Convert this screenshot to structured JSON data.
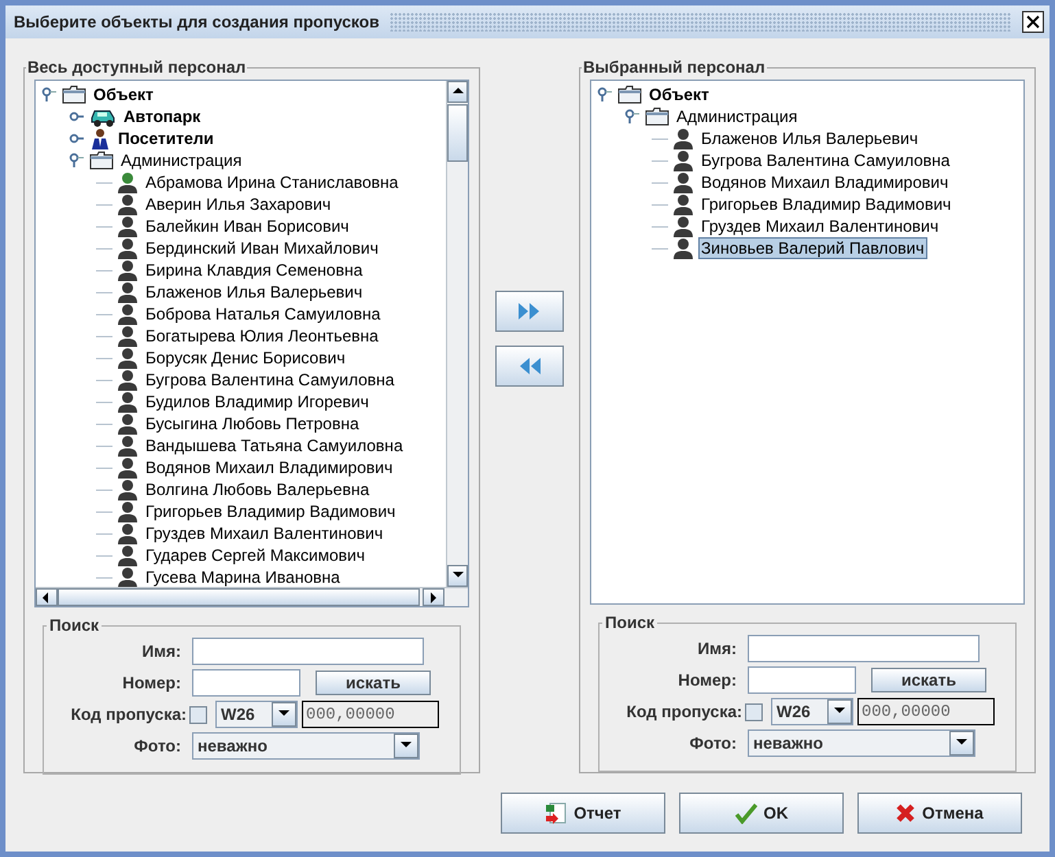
{
  "window": {
    "title": "Выберите объекты для создания пропусков"
  },
  "left_panel": {
    "title": "Весь доступный персонал",
    "tree": [
      {
        "label": "Объект",
        "kind": "folder",
        "bold": true,
        "expanded": true,
        "children": [
          {
            "label": "Автопарк",
            "kind": "car",
            "bold": true,
            "expanded": false
          },
          {
            "label": "Посетители",
            "kind": "visitor",
            "bold": true,
            "expanded": false
          },
          {
            "label": "Администрация",
            "kind": "folder",
            "bold": false,
            "expanded": true,
            "children": [
              {
                "label": "Абрамова Ирина Станиславовна",
                "kind": "green_person",
                "selected": false
              },
              {
                "label": "Аверин Илья Захарович",
                "kind": "person",
                "selected": false
              },
              {
                "label": "Балейкин Иван Борисович",
                "kind": "person",
                "selected": false
              },
              {
                "label": "Бердинский Иван Михайлович",
                "kind": "person",
                "selected": false
              },
              {
                "label": "Бирина Клавдия Семеновна",
                "kind": "person",
                "selected": false
              },
              {
                "label": "Блаженов Илья Валерьевич",
                "kind": "person",
                "selected": false
              },
              {
                "label": "Боброва Наталья Самуиловна",
                "kind": "person",
                "selected": false
              },
              {
                "label": "Богатырева Юлия Леонтьевна",
                "kind": "person",
                "selected": false
              },
              {
                "label": "Борусяк Денис Борисович",
                "kind": "person",
                "selected": false
              },
              {
                "label": "Бугрова Валентина Самуиловна",
                "kind": "person",
                "selected": false
              },
              {
                "label": "Будилов Владимир Игоревич",
                "kind": "person",
                "selected": false
              },
              {
                "label": "Бусыгина Любовь Петровна",
                "kind": "person",
                "selected": false
              },
              {
                "label": "Вандышева Татьяна Самуиловна",
                "kind": "person",
                "selected": false
              },
              {
                "label": "Водянов Михаил Владимирович",
                "kind": "person",
                "selected": false
              },
              {
                "label": "Волгина Любовь Валерьевна",
                "kind": "person",
                "selected": false
              },
              {
                "label": "Григорьев Владимир Вадимович",
                "kind": "person",
                "selected": false
              },
              {
                "label": "Груздев Михаил Валентинович",
                "kind": "person",
                "selected": false
              },
              {
                "label": "Гударев Сергей Максимович",
                "kind": "person",
                "selected": false
              },
              {
                "label": "Гусева Марина Ивановна",
                "kind": "person",
                "selected": false
              }
            ]
          }
        ]
      }
    ],
    "search": {
      "title": "Поиск",
      "name_label": "Имя:",
      "number_label": "Номер:",
      "search_button": "искать",
      "code_label": "Код пропуска:",
      "code_checked": false,
      "code_type": "W26",
      "code_value": "000,00000",
      "photo_label": "Фото:",
      "photo_value": "неважно"
    }
  },
  "move_buttons": [
    {
      "kind": "add"
    },
    {
      "kind": "remove"
    }
  ],
  "right_panel": {
    "title": "Выбранный персонал",
    "tree": [
      {
        "label": "Объект",
        "kind": "folder",
        "bold": true,
        "expanded": true,
        "children": [
          {
            "label": "Администрация",
            "kind": "folder",
            "bold": false,
            "expanded": true,
            "children": [
              {
                "label": "Блаженов Илья Валерьевич",
                "kind": "person",
                "selected": false
              },
              {
                "label": "Бугрова Валентина Самуиловна",
                "kind": "person",
                "selected": false
              },
              {
                "label": "Водянов Михаил Владимирович",
                "kind": "person",
                "selected": false
              },
              {
                "label": "Григорьев Владимир Вадимович",
                "kind": "person",
                "selected": false
              },
              {
                "label": "Груздев Михаил Валентинович",
                "kind": "person",
                "selected": false
              },
              {
                "label": "Зиновьев Валерий Павлович",
                "kind": "person",
                "selected": true
              }
            ]
          }
        ]
      }
    ],
    "search": {
      "title": "Поиск",
      "name_label": "Имя:",
      "number_label": "Номер:",
      "search_button": "искать",
      "code_label": "Код пропуска:",
      "code_checked": false,
      "code_type": "W26",
      "code_value": "000,00000",
      "photo_label": "Фото:",
      "photo_value": "неважно"
    }
  },
  "buttons": [
    {
      "kind": "report",
      "label": "Отчет"
    },
    {
      "kind": "ok",
      "label": "OK"
    },
    {
      "kind": "cancel",
      "label": "Отмена"
    }
  ]
}
